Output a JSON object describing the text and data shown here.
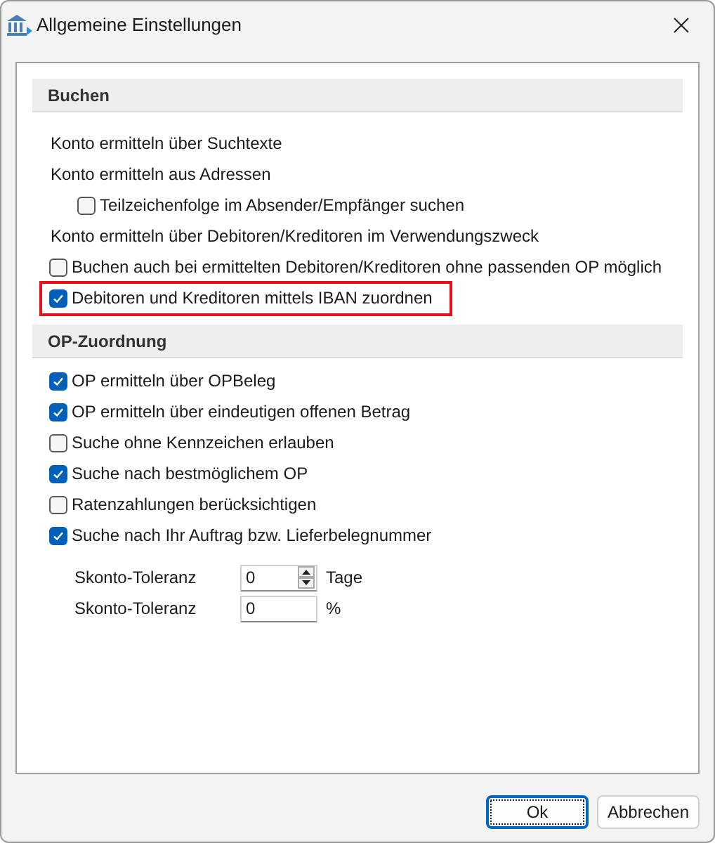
{
  "window": {
    "title": "Allgemeine Einstellungen"
  },
  "sections": [
    {
      "title": "Buchen",
      "items": [
        {
          "kind": "label",
          "text": "Konto ermitteln über Suchtexte"
        },
        {
          "kind": "label",
          "text": "Konto ermitteln aus Adressen"
        },
        {
          "kind": "checkbox",
          "text": "Teilzeichenfolge im Absender/Empfänger suchen",
          "checked": false,
          "indented": true,
          "highlighted": false
        },
        {
          "kind": "label",
          "text": "Konto ermitteln über Debitoren/Kreditoren im Verwendungszweck"
        },
        {
          "kind": "checkbox",
          "text": "Buchen auch bei ermittelten Debitoren/Kreditoren ohne passenden OP möglich",
          "checked": false,
          "indented": false,
          "highlighted": false
        },
        {
          "kind": "checkbox",
          "text": "Debitoren und Kreditoren mittels IBAN zuordnen",
          "checked": true,
          "indented": false,
          "highlighted": true
        }
      ]
    },
    {
      "title": "OP-Zuordnung",
      "items": [
        {
          "kind": "checkbox",
          "text": "OP ermitteln über OPBeleg",
          "checked": true,
          "indented": false,
          "highlighted": false
        },
        {
          "kind": "checkbox",
          "text": "OP ermitteln über eindeutigen offenen Betrag",
          "checked": true,
          "indented": false,
          "highlighted": false
        },
        {
          "kind": "checkbox",
          "text": "Suche ohne Kennzeichen erlauben",
          "checked": false,
          "indented": false,
          "highlighted": false
        },
        {
          "kind": "checkbox",
          "text": "Suche nach bestmöglichem OP",
          "checked": true,
          "indented": false,
          "highlighted": false
        },
        {
          "kind": "checkbox",
          "text": "Ratenzahlungen berücksichtigen",
          "checked": false,
          "indented": false,
          "highlighted": false
        },
        {
          "kind": "checkbox",
          "text": "Suche nach Ihr Auftrag bzw. Lieferbelegnummer",
          "checked": true,
          "indented": false,
          "highlighted": false
        }
      ],
      "fields": [
        {
          "label": "Skonto-Toleranz",
          "value": "0",
          "unit": "Tage",
          "spinner": true
        },
        {
          "label": "Skonto-Toleranz",
          "value": "0",
          "unit": "%",
          "spinner": false
        }
      ]
    }
  ],
  "buttons": [
    {
      "label": "Ok",
      "default": true
    },
    {
      "label": "Abbrechen",
      "default": false
    }
  ]
}
